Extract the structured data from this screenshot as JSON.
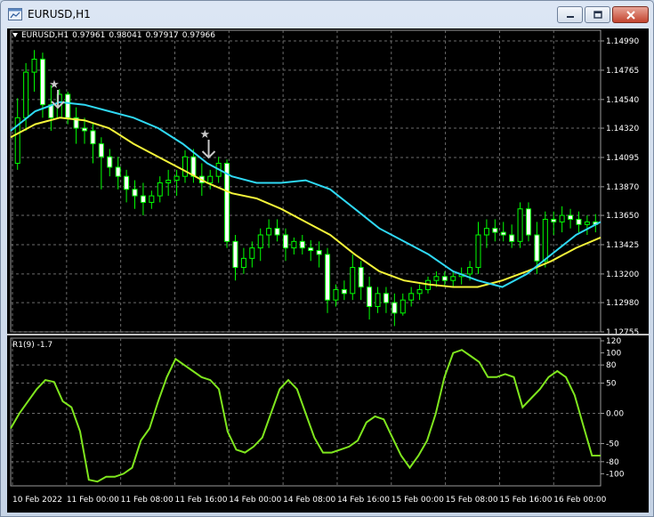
{
  "window": {
    "title": "EURUSD,H1"
  },
  "chart_header": {
    "symbol": "EURUSD,H1",
    "open": "0.97961",
    "high": "0.98041",
    "low": "0.97917",
    "close": "0.97966"
  },
  "indicator": {
    "label": "R1(9) -1.7"
  },
  "colors": {
    "background": "#000000",
    "grid": "#6b6b6b",
    "candle": "#00ff00",
    "ma_fast": "#2fd9f5",
    "ma_slow": "#f5f53a",
    "oscillator": "#7fe61e",
    "arrow": "#c8c8c8",
    "text": "#ffffff"
  },
  "icons": [
    "chart-window-icon",
    "minimize-icon",
    "maximize-icon",
    "close-icon",
    "star-icon",
    "down-arrow-icon"
  ],
  "chart_data": [
    {
      "type": "candlestick",
      "title": "EURUSD,H1",
      "y_ticks": [
        "1.14990",
        "1.14765",
        "1.14540",
        "1.14320",
        "1.14095",
        "1.13870",
        "1.13650",
        "1.13425",
        "1.13200",
        "1.12980",
        "1.12755"
      ],
      "ylim": [
        1.12755,
        1.1499
      ],
      "x_ticks": [
        "10 Feb 2022",
        "11 Feb 00:00",
        "11 Feb 08:00",
        "11 Feb 16:00",
        "14 Feb 00:00",
        "14 Feb 08:00",
        "14 Feb 16:00",
        "15 Feb 00:00",
        "15 Feb 08:00",
        "15 Feb 16:00",
        "16 Feb 00:00"
      ],
      "grid": true,
      "series": [
        {
          "kind": "ohlc",
          "values": [
            [
              1.1405,
              1.1455,
              1.14,
              1.144
            ],
            [
              1.144,
              1.1482,
              1.143,
              1.1475
            ],
            [
              1.1475,
              1.1492,
              1.146,
              1.1485
            ],
            [
              1.1485,
              1.149,
              1.144,
              1.145
            ],
            [
              1.145,
              1.1465,
              1.143,
              1.144
            ],
            [
              1.144,
              1.1462,
              1.1445,
              1.1458
            ],
            [
              1.1458,
              1.146,
              1.1435,
              1.144
            ],
            [
              1.144,
              1.1448,
              1.142,
              1.1432
            ],
            [
              1.1432,
              1.144,
              1.142,
              1.143
            ],
            [
              1.143,
              1.1436,
              1.1405,
              1.142
            ],
            [
              1.142,
              1.1425,
              1.1385,
              1.141
            ],
            [
              1.141,
              1.1416,
              1.1395,
              1.1402
            ],
            [
              1.1402,
              1.141,
              1.1385,
              1.1395
            ],
            [
              1.1395,
              1.14,
              1.1375,
              1.1385
            ],
            [
              1.1385,
              1.1392,
              1.137,
              1.138
            ],
            [
              1.138,
              1.139,
              1.1365,
              1.1375
            ],
            [
              1.1375,
              1.1384,
              1.137,
              1.138
            ],
            [
              1.138,
              1.1395,
              1.1375,
              1.139
            ],
            [
              1.139,
              1.14,
              1.138,
              1.1392
            ],
            [
              1.1392,
              1.14,
              1.138,
              1.1395
            ],
            [
              1.1395,
              1.1415,
              1.139,
              1.141
            ],
            [
              1.141,
              1.1416,
              1.139,
              1.1395
            ],
            [
              1.1395,
              1.1405,
              1.138,
              1.139
            ],
            [
              1.139,
              1.14,
              1.1385,
              1.1395
            ],
            [
              1.1395,
              1.141,
              1.139,
              1.1405
            ],
            [
              1.1405,
              1.1408,
              1.134,
              1.1345
            ],
            [
              1.1345,
              1.135,
              1.1315,
              1.1325
            ],
            [
              1.1325,
              1.134,
              1.132,
              1.1332
            ],
            [
              1.1332,
              1.1345,
              1.1325,
              1.134
            ],
            [
              1.134,
              1.1355,
              1.133,
              1.135
            ],
            [
              1.135,
              1.1362,
              1.134,
              1.1355
            ],
            [
              1.1355,
              1.1362,
              1.1345,
              1.135
            ],
            [
              1.135,
              1.1355,
              1.133,
              1.134
            ],
            [
              1.134,
              1.1348,
              1.1335,
              1.1345
            ],
            [
              1.1345,
              1.135,
              1.1335,
              1.134
            ],
            [
              1.134,
              1.1346,
              1.133,
              1.1338
            ],
            [
              1.1338,
              1.1345,
              1.1325,
              1.1335
            ],
            [
              1.1335,
              1.134,
              1.129,
              1.13
            ],
            [
              1.13,
              1.1312,
              1.1295,
              1.1308
            ],
            [
              1.1308,
              1.1315,
              1.13,
              1.1305
            ],
            [
              1.1305,
              1.1335,
              1.13,
              1.1325
            ],
            [
              1.1325,
              1.133,
              1.13,
              1.131
            ],
            [
              1.131,
              1.1318,
              1.1285,
              1.1295
            ],
            [
              1.1295,
              1.131,
              1.129,
              1.1305
            ],
            [
              1.1305,
              1.131,
              1.129,
              1.1298
            ],
            [
              1.1298,
              1.1305,
              1.128,
              1.129
            ],
            [
              1.129,
              1.1305,
              1.1288,
              1.13
            ],
            [
              1.13,
              1.131,
              1.1295,
              1.1305
            ],
            [
              1.1305,
              1.1312,
              1.13,
              1.1308
            ],
            [
              1.1308,
              1.1318,
              1.1305,
              1.1315
            ],
            [
              1.1315,
              1.1322,
              1.131,
              1.1318
            ],
            [
              1.1318,
              1.1322,
              1.131,
              1.1315
            ],
            [
              1.1315,
              1.1322,
              1.131,
              1.1318
            ],
            [
              1.1318,
              1.1325,
              1.1312,
              1.132
            ],
            [
              1.132,
              1.133,
              1.1315,
              1.1325
            ],
            [
              1.1325,
              1.136,
              1.132,
              1.135
            ],
            [
              1.135,
              1.1362,
              1.134,
              1.1355
            ],
            [
              1.1355,
              1.1362,
              1.1345,
              1.1352
            ],
            [
              1.1352,
              1.136,
              1.1345,
              1.135
            ],
            [
              1.135,
              1.1358,
              1.134,
              1.1345
            ],
            [
              1.1345,
              1.1375,
              1.134,
              1.137
            ],
            [
              1.137,
              1.1375,
              1.1345,
              1.135
            ],
            [
              1.135,
              1.136,
              1.132,
              1.133
            ],
            [
              1.133,
              1.1368,
              1.1325,
              1.1362
            ],
            [
              1.1362,
              1.1368,
              1.135,
              1.136
            ],
            [
              1.136,
              1.1372,
              1.1352,
              1.1365
            ],
            [
              1.1365,
              1.137,
              1.1355,
              1.1362
            ],
            [
              1.1362,
              1.1368,
              1.1352,
              1.1358
            ],
            [
              1.1358,
              1.1365,
              1.135,
              1.136
            ],
            [
              1.136,
              1.1366,
              1.1352,
              1.1358
            ]
          ]
        },
        {
          "kind": "ma_fast",
          "values": [
            1.143,
            1.1445,
            1.1452,
            1.145,
            1.1445,
            1.144,
            1.1432,
            1.142,
            1.1405,
            1.1395,
            1.139,
            1.139,
            1.1392,
            1.1385,
            1.137,
            1.1355,
            1.1345,
            1.1335,
            1.1322,
            1.1315,
            1.131,
            1.132,
            1.1335,
            1.135,
            1.136
          ]
        },
        {
          "kind": "ma_slow",
          "values": [
            1.1425,
            1.1435,
            1.144,
            1.1438,
            1.1432,
            1.142,
            1.141,
            1.14,
            1.139,
            1.1382,
            1.1378,
            1.137,
            1.136,
            1.135,
            1.1335,
            1.1322,
            1.1315,
            1.1312,
            1.131,
            1.131,
            1.1315,
            1.1322,
            1.133,
            1.134,
            1.1348
          ]
        }
      ]
    },
    {
      "type": "line",
      "title": "R1(9) -1.7",
      "y_ticks": [
        "120",
        "100",
        "80",
        "50",
        "0.00",
        "-50",
        "-80",
        "-100"
      ],
      "ylim": [
        -120,
        120
      ],
      "grid": true,
      "series": [
        {
          "values": [
            -25,
            0,
            20,
            40,
            55,
            52,
            20,
            10,
            -30,
            -110,
            -113,
            -105,
            -105,
            -100,
            -90,
            -45,
            -25,
            20,
            60,
            90,
            80,
            70,
            60,
            55,
            40,
            -30,
            -60,
            -65,
            -55,
            -40,
            0,
            40,
            55,
            40,
            0,
            -40,
            -65,
            -65,
            -60,
            -55,
            -45,
            -15,
            -5,
            -10,
            -40,
            -70,
            -90,
            -70,
            -45,
            0,
            60,
            100,
            105,
            95,
            85,
            60,
            60,
            65,
            60,
            10,
            25,
            40,
            60,
            70,
            60,
            30,
            -20,
            -70,
            -70
          ]
        }
      ]
    }
  ]
}
